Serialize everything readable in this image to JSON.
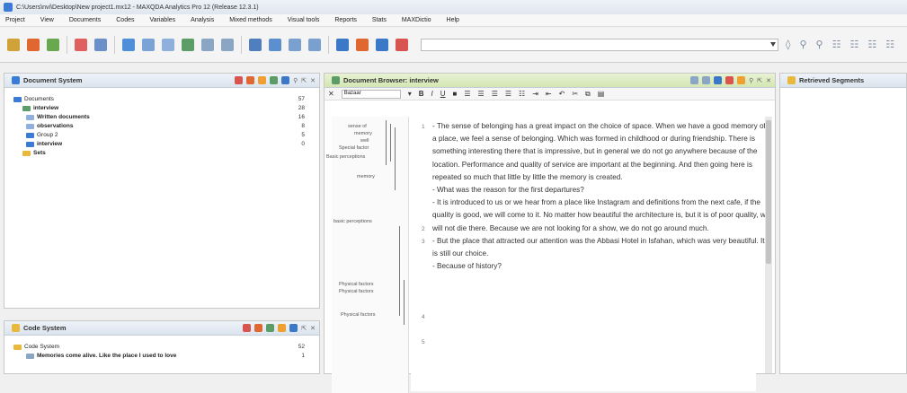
{
  "window": {
    "title": "C:\\Users\\nvi\\Desktop\\New project1.mx12 - MAXQDA Analytics Pro 12 (Release 12.3.1)"
  },
  "menu": [
    "Project",
    "View",
    "Documents",
    "Codes",
    "Variables",
    "Analysis",
    "Mixed methods",
    "Visual tools",
    "Reports",
    "Stats",
    "MAXDictio",
    "Help"
  ],
  "document_system": {
    "title": "Document System",
    "items": [
      {
        "label": "Documents",
        "count": "57"
      },
      {
        "label": "interview",
        "count": "28"
      },
      {
        "label": "Written documents",
        "count": "16"
      },
      {
        "label": "observations",
        "count": "8"
      },
      {
        "label": "Group 2",
        "count": "5"
      },
      {
        "label": "interview",
        "count": "0"
      },
      {
        "label": "Sets",
        "count": ""
      }
    ]
  },
  "code_system": {
    "title": "Code System",
    "items": [
      {
        "label": "Code System",
        "count": "52"
      },
      {
        "label": "Memories come alive. Like the place I used to love",
        "count": "1"
      }
    ]
  },
  "document_browser": {
    "title": "Document Browser: interview",
    "font_field": "Bazaar",
    "code_labels": [
      "sense of",
      "memory",
      "well",
      "Special factor",
      "Basic perceptions",
      "memory",
      "basic perceptions",
      "Physical factors",
      "Physical factors",
      "Physical factors"
    ],
    "paragraphs": [
      {
        "num": "1",
        "text": "- The sense of belonging has a great impact on the choice of space. When we have a good memory of a place, we feel a sense of belonging. Which was formed in childhood or during friendship. There is something interesting there that is impressive, but in general we do not go anywhere because of the location. Performance and quality of service are important at the beginning. And then going here is repeated so much that little by little the memory is created."
      },
      {
        "num": "2",
        "text": "- What was the reason for the first departures?"
      },
      {
        "num": "3",
        "text": "- It is introduced to us or we hear from a place like Instagram and definitions from the next cafe, if the quality is good, we will come to it. No matter how beautiful the architecture is, but it is of poor quality, we will not die there. Because we are not looking for a show, we do not go around much."
      },
      {
        "num": "4",
        "text": "- But the place that attracted our attention was the Abbasi Hotel in Isfahan, which was very beautiful. It is still our choice."
      },
      {
        "num": "5",
        "text": "- Because of history?"
      }
    ]
  },
  "retrieved_segments": {
    "title": "Retrieved Segments"
  },
  "colors": {
    "accent": "#3a7bd5",
    "code_red": "#d9534f",
    "code_orange": "#f0a030",
    "code_green": "#5cb85c",
    "folder_yellow": "#e8b93b"
  },
  "icons": [
    "document-system-icon",
    "code-system-icon",
    "document-browser-icon",
    "retrieved-segments-icon",
    "folder-icon",
    "document-icon"
  ]
}
